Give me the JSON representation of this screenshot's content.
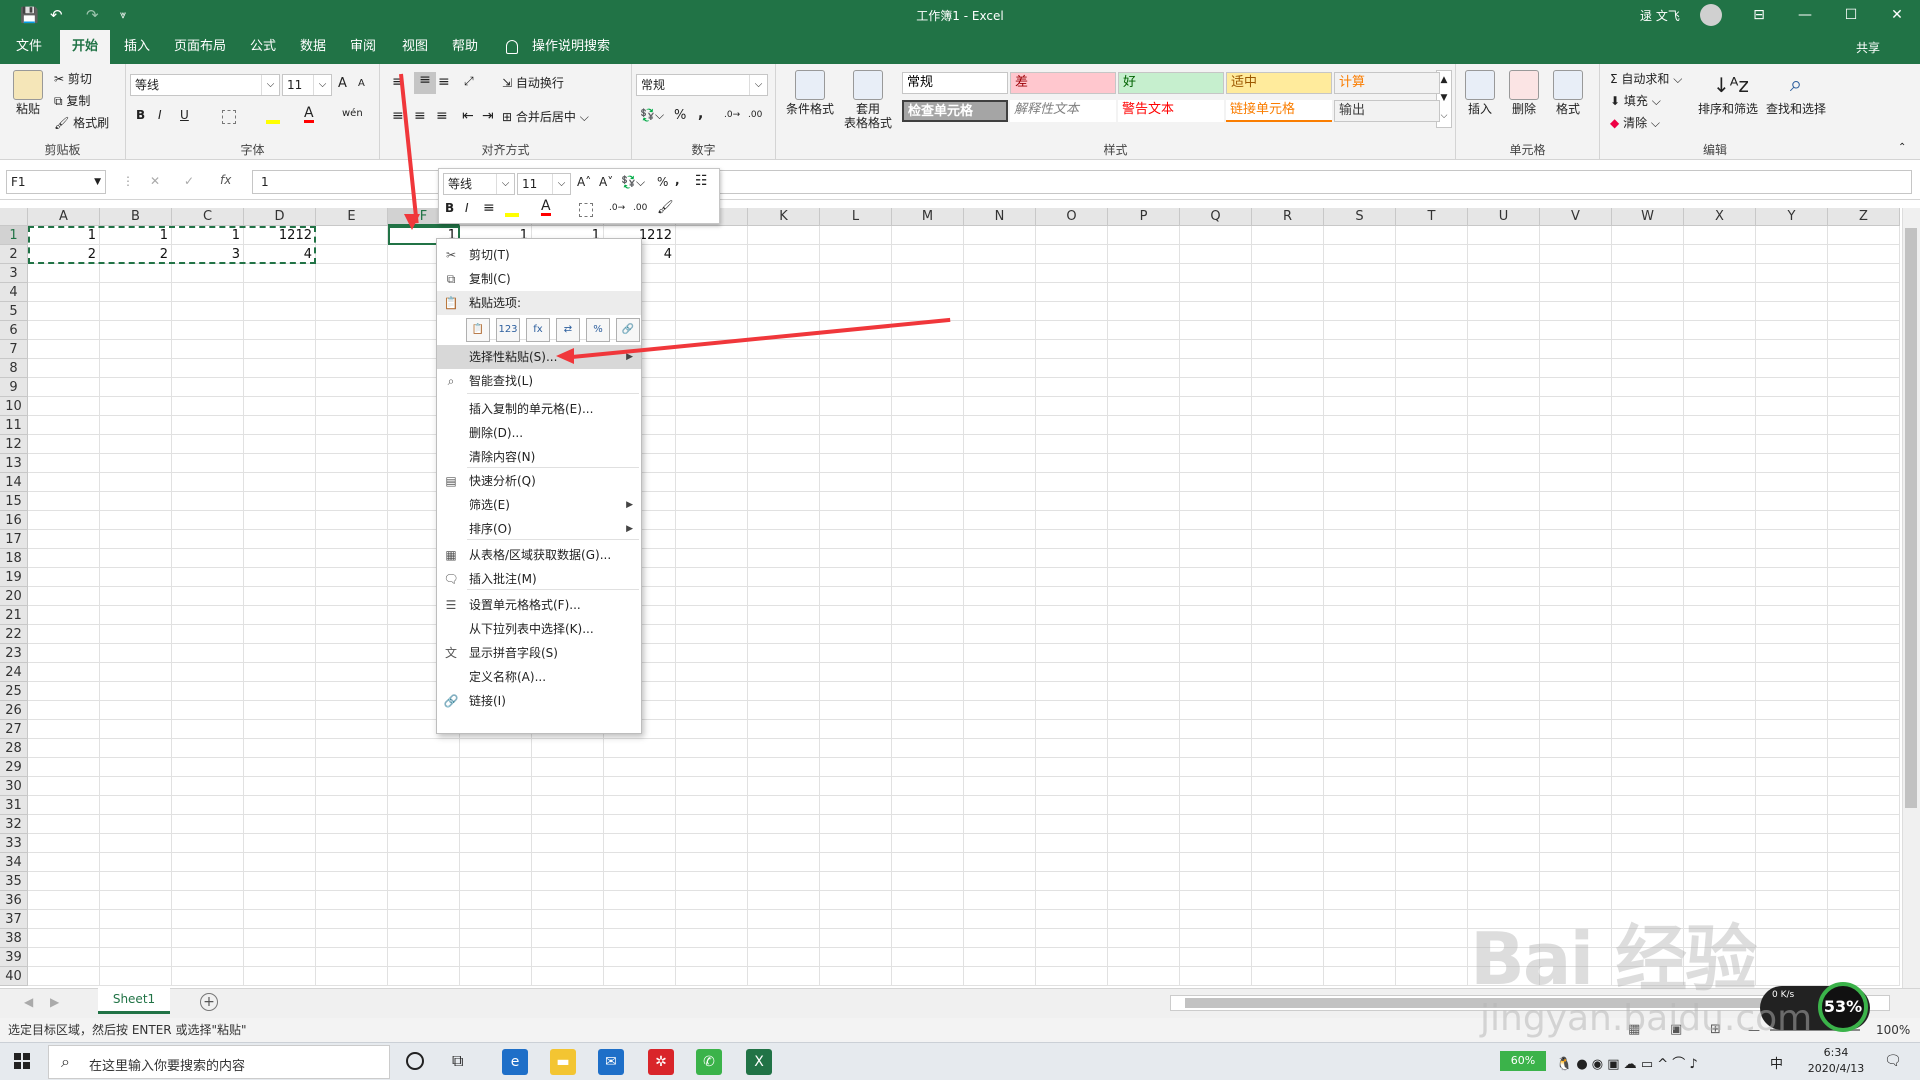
{
  "window": {
    "title": "工作簿1  -  Excel",
    "user": "逯 文飞",
    "controls": {
      "restore_ribbon": "⊟",
      "minimize": "—",
      "maximize": "☐",
      "close": "✕"
    }
  },
  "qat": {
    "save": "💾",
    "undo": "↶",
    "redo": "↷",
    "customize": "⩔"
  },
  "tabs": [
    "文件",
    "开始",
    "插入",
    "页面布局",
    "公式",
    "数据",
    "审阅",
    "视图",
    "帮助",
    "操作说明搜索"
  ],
  "share": "共享",
  "ribbon": {
    "clipboard": {
      "paste": "粘贴",
      "cut": "剪切",
      "copy": "复制",
      "format_painter": "格式刷",
      "label": "剪贴板"
    },
    "font": {
      "name": "等线",
      "size": "11",
      "bold": "B",
      "italic": "I",
      "underline": "U",
      "grow": "A",
      "shrink": "A",
      "label": "字体"
    },
    "align": {
      "wrap": "自动换行",
      "merge": "合并后居中",
      "label": "对齐方式"
    },
    "number": {
      "format": "常规",
      "percent": "%",
      "comma": ",",
      "label": "数字"
    },
    "styles": {
      "cond": "条件格式",
      "table": "套用\n表格格式",
      "items": [
        {
          "text": "常规",
          "bg": "#ffffff",
          "fg": "#000000"
        },
        {
          "text": "差",
          "bg": "#ffc7ce",
          "fg": "#9c0006"
        },
        {
          "text": "好",
          "bg": "#c6efce",
          "fg": "#006100"
        },
        {
          "text": "适中",
          "bg": "#ffeb9c",
          "fg": "#9c5700"
        },
        {
          "text": "计算",
          "bg": "#f2f2f2",
          "fg": "#fa7d00"
        },
        {
          "text": "检查单元格",
          "bg": "#a5a5a5",
          "fg": "#ffffff"
        },
        {
          "text": "解释性文本",
          "bg": "#ffffff",
          "fg": "#7f7f7f"
        },
        {
          "text": "警告文本",
          "bg": "#ffffff",
          "fg": "#ff0000"
        },
        {
          "text": "链接单元格",
          "bg": "#ffffff",
          "fg": "#fa7d00"
        },
        {
          "text": "输出",
          "bg": "#f2f2f2",
          "fg": "#3f3f3f"
        }
      ],
      "label": "样式"
    },
    "cells": {
      "insert": "插入",
      "delete": "删除",
      "format": "格式",
      "label": "单元格"
    },
    "edit": {
      "autosum": "自动求和",
      "fill": "填充",
      "clear": "清除",
      "sort": "排序和筛选",
      "find": "查找和选择",
      "label": "编辑"
    }
  },
  "formula_bar": {
    "namebox": "F1",
    "value": "1",
    "fx": "fx",
    "cancel": "✕",
    "enter": "✓"
  },
  "mini_toolbar": {
    "font": "等线",
    "size": "11",
    "percent": "%",
    "comma": ","
  },
  "columns": [
    "A",
    "B",
    "C",
    "D",
    "E",
    "F",
    "G",
    "H",
    "I",
    "J",
    "K",
    "L",
    "M",
    "N",
    "O",
    "P",
    "Q",
    "R",
    "S",
    "T",
    "U",
    "V",
    "W",
    "X",
    "Y",
    "Z"
  ],
  "rows": [
    "1",
    "2",
    "3",
    "4",
    "5",
    "6",
    "7",
    "8",
    "9",
    "10",
    "11",
    "12",
    "13",
    "14",
    "15",
    "16",
    "17",
    "18",
    "19",
    "20",
    "21",
    "22",
    "23",
    "24",
    "25",
    "26",
    "27",
    "28",
    "29",
    "30",
    "31",
    "32",
    "33",
    "34",
    "35",
    "36",
    "37",
    "38",
    "39",
    "40"
  ],
  "cells": [
    {
      "r": 0,
      "c": 0,
      "v": "1"
    },
    {
      "r": 0,
      "c": 1,
      "v": "1"
    },
    {
      "r": 0,
      "c": 2,
      "v": "1"
    },
    {
      "r": 0,
      "c": 3,
      "v": "1212"
    },
    {
      "r": 1,
      "c": 0,
      "v": "2"
    },
    {
      "r": 1,
      "c": 1,
      "v": "2"
    },
    {
      "r": 1,
      "c": 2,
      "v": "3"
    },
    {
      "r": 1,
      "c": 3,
      "v": "4"
    },
    {
      "r": 0,
      "c": 5,
      "v": "1"
    },
    {
      "r": 0,
      "c": 6,
      "v": "1"
    },
    {
      "r": 0,
      "c": 7,
      "v": "1"
    },
    {
      "r": 0,
      "c": 8,
      "v": "1212"
    },
    {
      "r": 1,
      "c": 8,
      "v": "4"
    }
  ],
  "context_menu": {
    "items": [
      {
        "label": "剪切(T)",
        "icon": "✂"
      },
      {
        "label": "复制(C)",
        "icon": "⧉"
      },
      {
        "label": "粘贴选项:",
        "icon": "📋"
      },
      {
        "label": "选择性粘贴(S)...",
        "icon": "",
        "sub": "▶"
      },
      {
        "label": "智能查找(L)",
        "icon": "⌕"
      },
      {
        "label": "插入复制的单元格(E)...",
        "icon": ""
      },
      {
        "label": "删除(D)...",
        "icon": ""
      },
      {
        "label": "清除内容(N)",
        "icon": ""
      },
      {
        "label": "快速分析(Q)",
        "icon": "▤"
      },
      {
        "label": "筛选(E)",
        "icon": "",
        "sub": "▶"
      },
      {
        "label": "排序(O)",
        "icon": "",
        "sub": "▶"
      },
      {
        "label": "从表格/区域获取数据(G)...",
        "icon": "▦"
      },
      {
        "label": "插入批注(M)",
        "icon": "🗨"
      },
      {
        "label": "设置单元格格式(F)...",
        "icon": "☰"
      },
      {
        "label": "从下拉列表中选择(K)...",
        "icon": ""
      },
      {
        "label": "显示拼音字段(S)",
        "icon": "文"
      },
      {
        "label": "定义名称(A)...",
        "icon": ""
      },
      {
        "label": "链接(I)",
        "icon": "🔗"
      }
    ],
    "paste_icons": [
      "📋",
      "123",
      "fx",
      "⇄",
      "%",
      "🔗"
    ]
  },
  "sheet_tab": "Sheet1",
  "status": "选定目标区域，然后按 ENTER 或选择\"粘贴\"",
  "zoom": "100%",
  "taskbar": {
    "search_placeholder": "在这里输入你要搜索的内容",
    "battery": "60%",
    "time": "6:34",
    "date": "2020/4/13",
    "ime": "中",
    "net_speed": "0 K/s",
    "cpu": "53%"
  },
  "watermark": {
    "brand": "Bai 经验",
    "url": "jingyan.baidu.com"
  },
  "colors": {
    "excel_green": "#217346",
    "selection": "#217346",
    "arrow": "#f0373b"
  }
}
